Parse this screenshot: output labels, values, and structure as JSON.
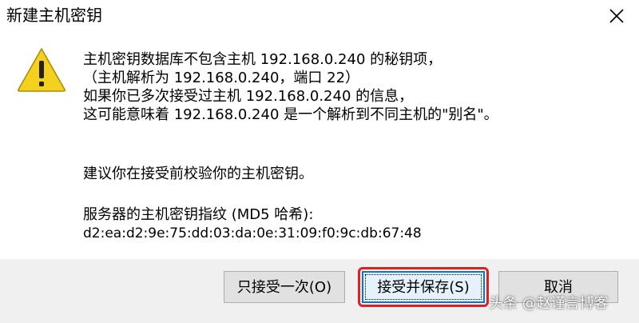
{
  "window": {
    "title": "新建主机密钥",
    "close_icon": "close-icon"
  },
  "dialog": {
    "icon": "warning-icon",
    "icon_color": "#f4d01f",
    "message_lines": [
      "主机密钥数据库不包含主机 192.168.0.240 的秘钥项，",
      "（主机解析为 192.168.0.240，端口 22）",
      "如果你已多次接受过主机 192.168.0.240 的信息，",
      "这可能意味着 192.168.0.240 是一个解析到不同主机的\"别名\"。"
    ],
    "advice": "建议你在接受前校验你的主机密钥。",
    "fingerprint_label": "服务器的主机密钥指纹 (MD5 哈希):",
    "fingerprint_value": "d2:ea:d2:9e:75:dd:03:da:0e:31:09:f0:9c:db:67:48"
  },
  "buttons": {
    "accept_once": "只接受一次(O)",
    "accept_and_save": "接受并保存(S)",
    "cancel": "取消"
  },
  "colors": {
    "highlight": "#e02020",
    "focus_border": "#0078d7"
  },
  "watermark": "头条 @赵谨言博客"
}
